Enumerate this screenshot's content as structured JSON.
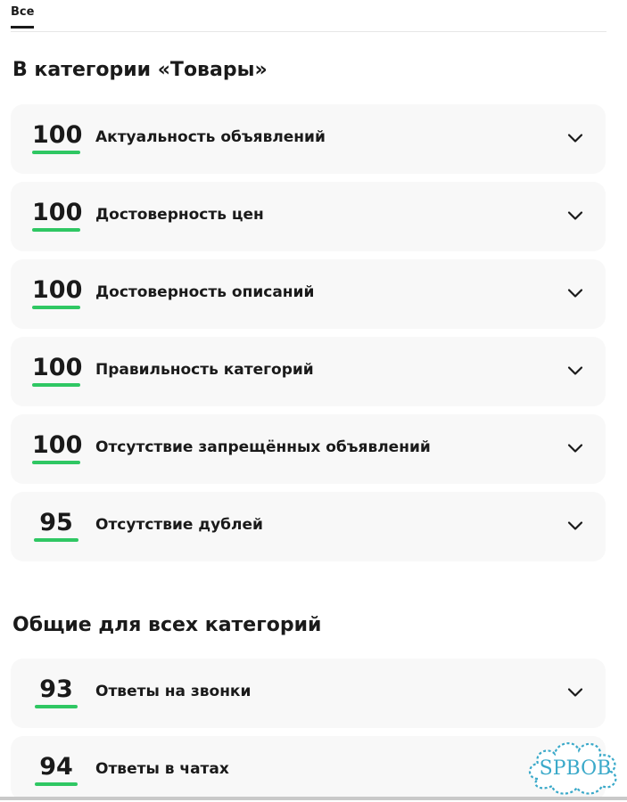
{
  "tabs": [
    {
      "label": "Все",
      "active": true
    }
  ],
  "sections": [
    {
      "title": "В категории «Товары»",
      "items": [
        {
          "score": "100",
          "label": "Актуальность объявлений"
        },
        {
          "score": "100",
          "label": "Достоверность цен"
        },
        {
          "score": "100",
          "label": "Достоверность описаний"
        },
        {
          "score": "100",
          "label": "Правильность категорий"
        },
        {
          "score": "100",
          "label": "Отсутствие запрещённых объявлений"
        },
        {
          "score": "95",
          "label": "Отсутствие дублей"
        }
      ]
    },
    {
      "title": "Общие для всех категорий",
      "items": [
        {
          "score": "93",
          "label": "Ответы на звонки"
        },
        {
          "score": "94",
          "label": "Ответы в чатах"
        }
      ]
    }
  ],
  "watermark": "SPBOB",
  "colors": {
    "accent": "#2fc763",
    "card_bg": "#f8f8f8",
    "text": "#1a1a1a",
    "watermark": "#3aa9c9"
  },
  "icons": {
    "expand": "chevron-down-icon"
  }
}
